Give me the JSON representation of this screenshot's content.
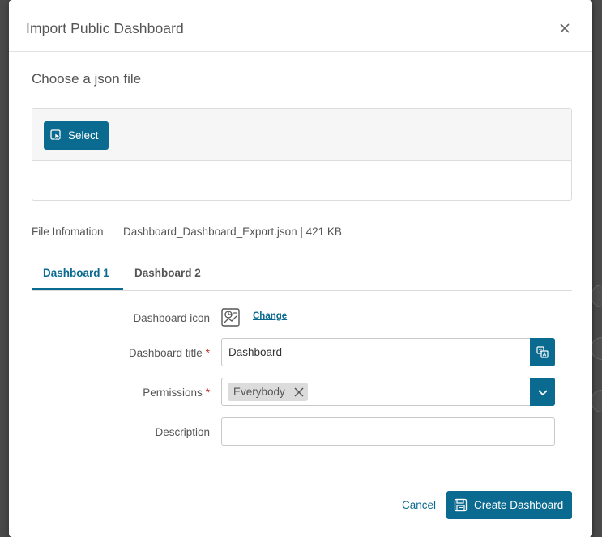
{
  "dialog": {
    "title": "Import Public Dashboard",
    "close_icon": "close-icon"
  },
  "upload": {
    "heading": "Choose a json file",
    "select_label": "Select",
    "select_icon": "select-file-icon"
  },
  "file_info": {
    "label": "File Infomation",
    "value": "Dashboard_Dashboard_Export.json | 421 KB"
  },
  "tabs": [
    {
      "label": "Dashboard 1",
      "active": true
    },
    {
      "label": "Dashboard 2",
      "active": false
    }
  ],
  "form": {
    "icon_label": "Dashboard icon",
    "icon_name": "dashboard-chart-icon",
    "change_link": "Change",
    "title_label": "Dashboard title",
    "title_value": "Dashboard",
    "title_addon_icon": "translate-icon",
    "permissions_label": "Permissions",
    "permissions_chips": [
      "Everybody"
    ],
    "description_label": "Description",
    "description_value": "",
    "required_mark": "*"
  },
  "footer": {
    "cancel_label": "Cancel",
    "create_label": "Create Dashboard",
    "create_icon": "save-icon"
  },
  "colors": {
    "accent": "#0b6a8f",
    "required": "#d0342c",
    "chip_bg": "#dcdcdc"
  }
}
